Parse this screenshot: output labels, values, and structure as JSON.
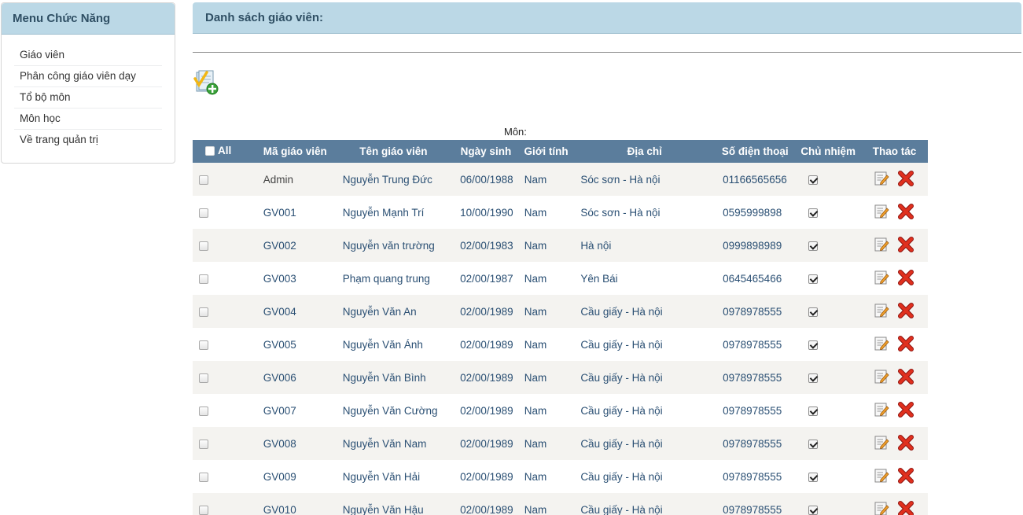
{
  "sidebar": {
    "title": "Menu Chức Năng",
    "items": [
      {
        "label": "Giáo viên"
      },
      {
        "label": "Phân công giáo viên dạy"
      },
      {
        "label": "Tổ bộ môn"
      },
      {
        "label": "Môn học"
      },
      {
        "label": "Về trang quản trị"
      }
    ]
  },
  "main": {
    "title": "Danh sách giáo viên:",
    "add_icon": "add-teacher-icon",
    "filter_label": "Môn:"
  },
  "table": {
    "all_label": "All",
    "headers": [
      "Mã giáo viên",
      "Tên giáo viên",
      "Ngày sinh",
      "Giới tính",
      "Địa chỉ",
      "Số điện thoại",
      "Chủ nhiệm",
      "Thao tác"
    ],
    "rows": [
      {
        "code": "Admin",
        "name": "Nguyễn Trung Đức",
        "dob": "06/00/1988",
        "sex": "Nam",
        "address": "Sóc sơn - Hà nội",
        "phone": "01166565656",
        "homeroom": true
      },
      {
        "code": "GV001",
        "name": "Nguyễn Mạnh Trí",
        "dob": "10/00/1990",
        "sex": "Nam",
        "address": "Sóc sơn - Hà nội",
        "phone": "0595999898",
        "homeroom": true
      },
      {
        "code": "GV002",
        "name": "Nguyễn văn trường",
        "dob": "02/00/1983",
        "sex": "Nam",
        "address": "Hà nội",
        "phone": "0999898989",
        "homeroom": true
      },
      {
        "code": "GV003",
        "name": "Phạm quang trung",
        "dob": "02/00/1987",
        "sex": "Nam",
        "address": "Yên Bái",
        "phone": "0645465466",
        "homeroom": true
      },
      {
        "code": "GV004",
        "name": "Nguyễn Văn An",
        "dob": "02/00/1989",
        "sex": "Nam",
        "address": "Cầu giấy - Hà nội",
        "phone": "0978978555",
        "homeroom": true
      },
      {
        "code": "GV005",
        "name": "Nguyễn Văn Ánh",
        "dob": "02/00/1989",
        "sex": "Nam",
        "address": "Cầu giấy - Hà nội",
        "phone": "0978978555",
        "homeroom": true
      },
      {
        "code": "GV006",
        "name": "Nguyễn Văn Bình",
        "dob": "02/00/1989",
        "sex": "Nam",
        "address": "Cầu giấy - Hà nội",
        "phone": "0978978555",
        "homeroom": true
      },
      {
        "code": "GV007",
        "name": "Nguyễn Văn Cường",
        "dob": "02/00/1989",
        "sex": "Nam",
        "address": "Cầu giấy - Hà nội",
        "phone": "0978978555",
        "homeroom": true
      },
      {
        "code": "GV008",
        "name": "Nguyễn Văn Nam",
        "dob": "02/00/1989",
        "sex": "Nam",
        "address": "Cầu giấy - Hà nội",
        "phone": "0978978555",
        "homeroom": true
      },
      {
        "code": "GV009",
        "name": "Nguyễn Văn Hải",
        "dob": "02/00/1989",
        "sex": "Nam",
        "address": "Cầu giấy - Hà nội",
        "phone": "0978978555",
        "homeroom": true
      },
      {
        "code": "GV010",
        "name": "Nguyễn Văn Hậu",
        "dob": "02/00/1989",
        "sex": "Nam",
        "address": "Cầu giấy - Hà nội",
        "phone": "0978978555",
        "homeroom": true
      }
    ],
    "action_icons": [
      "edit-icon",
      "delete-icon"
    ]
  },
  "colors": {
    "panel_header": "#bbd8e6",
    "table_header": "#5b7d9c",
    "row_alt": "#f4f3f0",
    "link": "#2a4f73",
    "delete": "#d7261b"
  }
}
